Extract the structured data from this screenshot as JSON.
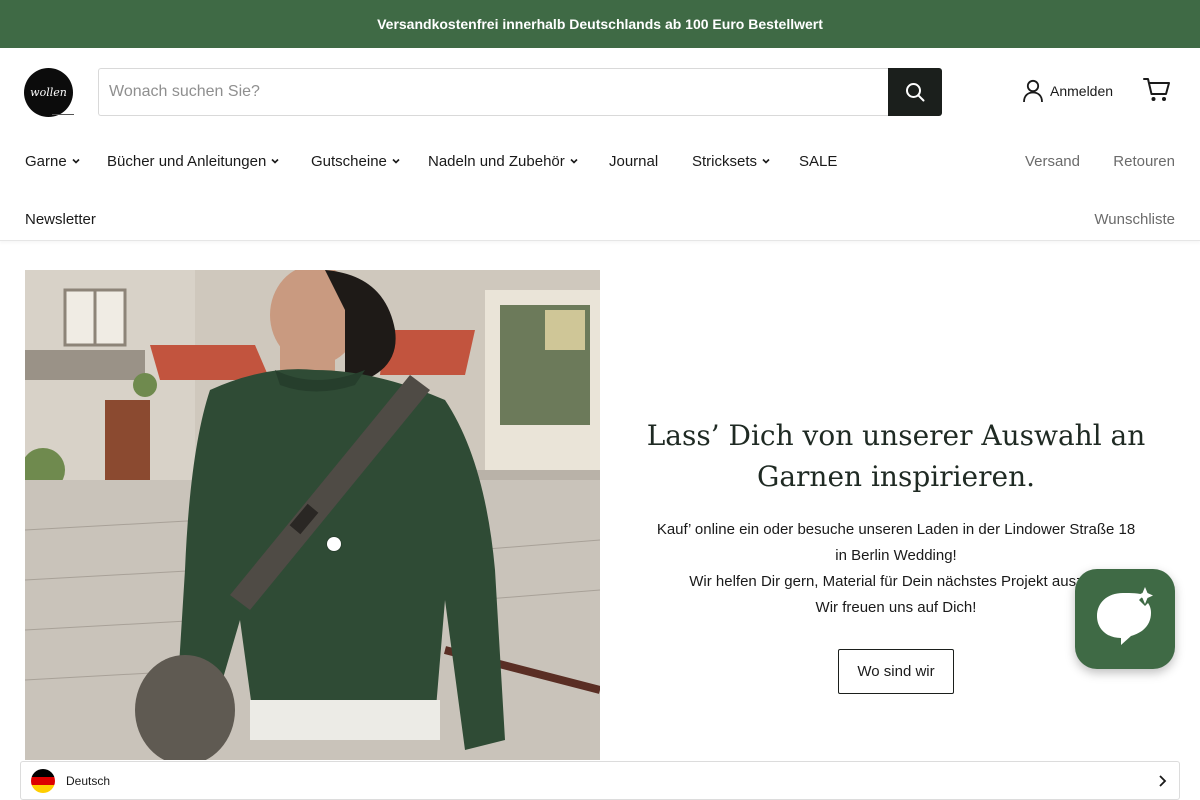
{
  "announcement": {
    "text": "Versandkostenfrei innerhalb Deutschlands ab 100 Euro Bestellwert"
  },
  "header": {
    "logo_text": "wollen",
    "search": {
      "placeholder": "Wonach suchen Sie?",
      "value": ""
    },
    "account_label": "Anmelden"
  },
  "nav": {
    "items": [
      {
        "label": "Garne",
        "has_dropdown": true
      },
      {
        "label": "Bücher und Anleitungen",
        "has_dropdown": true
      },
      {
        "label": "Gutscheine",
        "has_dropdown": true
      },
      {
        "label": "Nadeln und Zubehör",
        "has_dropdown": true
      },
      {
        "label": "Journal",
        "has_dropdown": false
      },
      {
        "label": "Stricksets",
        "has_dropdown": true
      },
      {
        "label": "SALE",
        "has_dropdown": false
      },
      {
        "label": "Newsletter",
        "has_dropdown": false
      }
    ],
    "secondary": [
      {
        "label": "Versand"
      },
      {
        "label": "Retouren"
      },
      {
        "label": "Wunschliste"
      }
    ]
  },
  "hero": {
    "title": "Lass’ Dich von unserer Auswahl an Garnen inspirieren.",
    "body_lines": [
      "Kauf’ online ein oder besuche unseren Laden in der Lindower Straße 18",
      "in Berlin Wedding!",
      "Wir helfen Dir gern, Material für Dein nächstes Projekt auszuw",
      "Wir freuen uns auf Dich!"
    ],
    "cta_label": "Wo sind wir"
  },
  "language_bar": {
    "label": "Deutsch",
    "flag_colors": [
      "#000000",
      "#dd0000",
      "#ffce00"
    ]
  },
  "colors": {
    "brand_green": "#3f6a45",
    "dark_button": "#1b1f1c",
    "sweater_green": "#2f4b35"
  },
  "icons": [
    "search-icon",
    "user-icon",
    "cart-icon",
    "chevron-down-icon",
    "chat-bubble-icon",
    "chevron-right-icon"
  ]
}
